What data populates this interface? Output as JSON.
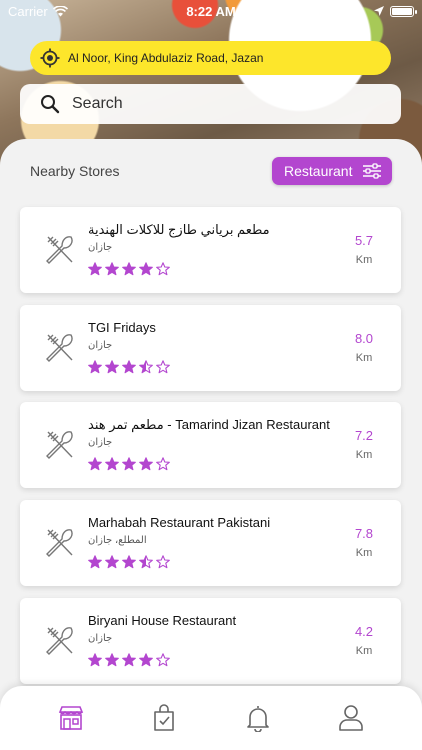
{
  "status_bar": {
    "carrier": "Carrier",
    "time": "8:22 AM"
  },
  "location": {
    "address": "Al Noor, King Abdulaziz Road, Jazan",
    "icon": "location-target-icon"
  },
  "search": {
    "placeholder": "Search",
    "icon": "search-icon"
  },
  "nearby": {
    "title": "Nearby Stores",
    "filter_label": "Restaurant",
    "filter_icon": "sliders-icon"
  },
  "stores": [
    {
      "name": "مطعم برياني طازج للاكلات الهندية",
      "area": "جازان",
      "rating": 4,
      "distance": "5.7",
      "unit": "Km"
    },
    {
      "name": "TGI Fridays",
      "area": "جازان",
      "rating": 3.5,
      "distance": "8.0",
      "unit": "Km"
    },
    {
      "name": "مطعم تمر هند - Tamarind Jizan Restaurant",
      "area": "جازان",
      "rating": 4,
      "distance": "7.2",
      "unit": "Km"
    },
    {
      "name": "Marhabah Restaurant Pakistani",
      "area": "المطلع، جازان",
      "rating": 3.5,
      "distance": "7.8",
      "unit": "Km"
    },
    {
      "name": "Biryani House Restaurant",
      "area": "جازان",
      "rating": 4,
      "distance": "4.2",
      "unit": "Km"
    }
  ],
  "tabs": [
    {
      "name": "store-tab",
      "icon": "store-icon",
      "active": true
    },
    {
      "name": "orders-tab",
      "icon": "shopping-bag-icon",
      "active": false
    },
    {
      "name": "notifications-tab",
      "icon": "bell-icon",
      "active": false
    },
    {
      "name": "profile-tab",
      "icon": "user-icon",
      "active": false
    }
  ],
  "colors": {
    "accent": "#b346cf",
    "location_bg": "#fde62b",
    "star": "#b346cf"
  }
}
